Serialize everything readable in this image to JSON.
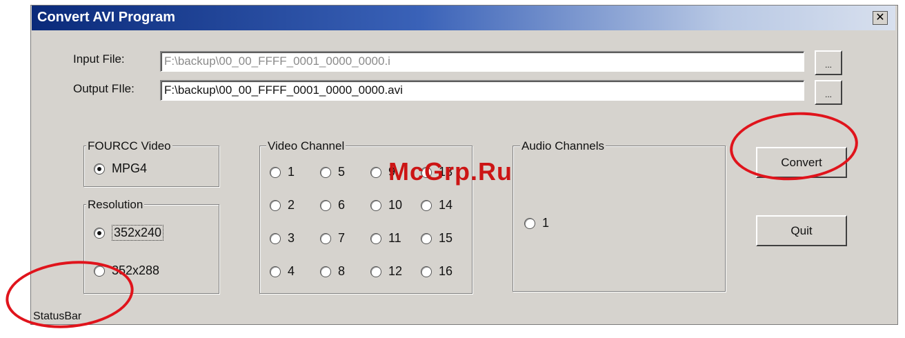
{
  "window": {
    "title": "Convert AVI Program",
    "close_label": "✕"
  },
  "input_file": {
    "label": "Input File:",
    "value": "F:\\backup\\00_00_FFFF_0001_0000_0000.i",
    "browse": "..."
  },
  "output_file": {
    "label": "Output FIle:",
    "value": "F:\\backup\\00_00_FFFF_0001_0000_0000.avi",
    "browse": "..."
  },
  "fourcc": {
    "title": "FOURCC Video",
    "option": "MPG4",
    "selected": true
  },
  "resolution": {
    "title": "Resolution",
    "options": [
      "352x240",
      "352x288"
    ],
    "selected": "352x240"
  },
  "video_channel": {
    "title": "Video Channel",
    "options": [
      "1",
      "2",
      "3",
      "4",
      "5",
      "6",
      "7",
      "8",
      "9",
      "10",
      "11",
      "12",
      "13",
      "14",
      "15",
      "16"
    ]
  },
  "audio_channels": {
    "title": "Audio Channels",
    "options": [
      "1"
    ]
  },
  "buttons": {
    "convert": "Convert",
    "quit": "Quit"
  },
  "status_bar": "StatusBar",
  "watermark": "McGrp.Ru",
  "colors": {
    "annotation_red": "#e0141c",
    "title_bar": "#0a2a7a",
    "dialog_bg": "#d6d3ce"
  }
}
